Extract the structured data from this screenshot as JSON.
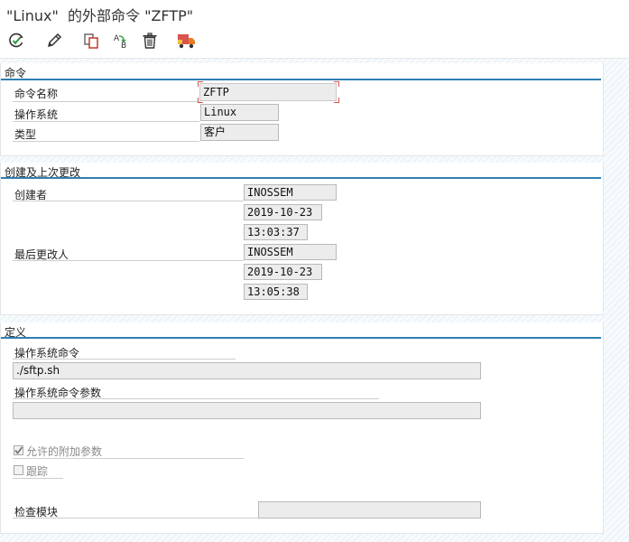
{
  "window": {
    "title": "\"Linux\"  的外部命令 \"ZFTP\""
  },
  "toolbar": {
    "buttons": [
      {
        "name": "check-icon"
      },
      {
        "name": "pencil-icon"
      },
      {
        "name": "copy-icon"
      },
      {
        "name": "rename-icon"
      },
      {
        "name": "trash-icon"
      },
      {
        "name": "transport-truck-icon"
      }
    ],
    "rename_icon_letters": "AB"
  },
  "command_section": {
    "title": "命令",
    "command_name_label": "命令名称",
    "command_name_value": "ZFTP",
    "os_label": "操作系统",
    "os_value": "Linux",
    "type_label": "类型",
    "type_value": "客户"
  },
  "history_section": {
    "title": "创建及上次更改",
    "created_by_label": "创建者",
    "created_by": "INOSSEM",
    "created_date": "2019-10-23",
    "created_time": "13:03:37",
    "changed_by_label": "最后更改人",
    "changed_by": "INOSSEM",
    "changed_date": "2019-10-23",
    "changed_time": "13:05:38"
  },
  "definition_section": {
    "title": "定义",
    "os_command_label": "操作系统命令",
    "os_command_value": "./sftp.sh",
    "os_params_label": "操作系统命令参数",
    "os_params_value": "",
    "allow_params_label": "允许的附加参数",
    "allow_params_checked": true,
    "trace_label": "跟踪",
    "trace_checked": false,
    "check_module_label": "检查模块",
    "check_module_value": ""
  }
}
